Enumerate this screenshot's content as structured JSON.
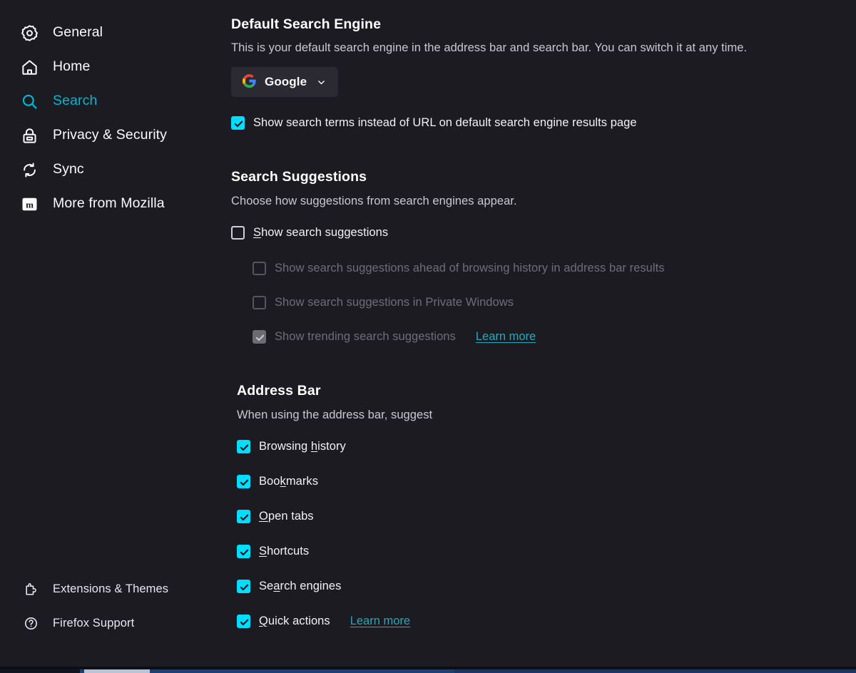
{
  "app": {
    "page": "Firefox Settings — Search"
  },
  "sidebar": {
    "items": [
      {
        "id": "general",
        "label": "General",
        "icon": "gear-icon",
        "active": false
      },
      {
        "id": "home",
        "label": "Home",
        "icon": "home-icon",
        "active": false
      },
      {
        "id": "search",
        "label": "Search",
        "icon": "search-icon",
        "active": true
      },
      {
        "id": "privacy",
        "label": "Privacy & Security",
        "icon": "lock-icon",
        "active": false
      },
      {
        "id": "sync",
        "label": "Sync",
        "icon": "sync-icon",
        "active": false
      },
      {
        "id": "mozilla",
        "label": "More from Mozilla",
        "icon": "mozilla-icon",
        "active": false
      }
    ],
    "footer": [
      {
        "id": "extensions",
        "label": "Extensions & Themes",
        "icon": "puzzle-icon"
      },
      {
        "id": "support",
        "label": "Firefox Support",
        "icon": "help-circle-icon"
      }
    ]
  },
  "default_search_engine": {
    "title": "Default Search Engine",
    "description": "This is your default search engine in the address bar and search bar. You can switch it at any time.",
    "selected_engine": "Google",
    "engine_icon": "google-g-icon",
    "chevron_icon": "chevron-down-icon",
    "checkbox": {
      "label": "Show search terms instead of URL on default search engine results page",
      "checked": true,
      "disabled": false
    }
  },
  "search_suggestions": {
    "title": "Search Suggestions",
    "description": "Choose how suggestions from search engines appear.",
    "items": [
      {
        "label_pre": "",
        "accesskey": "S",
        "label_post": "how search suggestions",
        "checked": false,
        "disabled": false,
        "indent": false,
        "learn_more": null
      },
      {
        "label_pre": "Show search suggestions ahead of browsing history in address bar results",
        "accesskey": "",
        "label_post": "",
        "checked": false,
        "disabled": true,
        "indent": true,
        "learn_more": null
      },
      {
        "label_pre": "Show search suggestions in Private Windows",
        "accesskey": "",
        "label_post": "",
        "checked": false,
        "disabled": true,
        "indent": true,
        "learn_more": null
      },
      {
        "label_pre": "Show trending search suggestions",
        "accesskey": "",
        "label_post": "",
        "checked": true,
        "disabled": true,
        "indent": true,
        "learn_more": "Learn more"
      }
    ]
  },
  "address_bar": {
    "title": "Address Bar",
    "description": "When using the address bar, suggest",
    "items": [
      {
        "label_pre": "Browsing ",
        "accesskey": "h",
        "label_post": "istory",
        "checked": true,
        "learn_more": null
      },
      {
        "label_pre": "Boo",
        "accesskey": "k",
        "label_post": "marks",
        "checked": true,
        "learn_more": null
      },
      {
        "label_pre": "",
        "accesskey": "O",
        "label_post": "pen tabs",
        "checked": true,
        "learn_more": null
      },
      {
        "label_pre": "",
        "accesskey": "S",
        "label_post": "hortcuts",
        "checked": true,
        "learn_more": null
      },
      {
        "label_pre": "Se",
        "accesskey": "a",
        "label_post": "rch engines",
        "checked": true,
        "learn_more": null
      },
      {
        "label_pre": "",
        "accesskey": "Q",
        "label_post": "uick actions",
        "checked": true,
        "learn_more": "Learn more"
      }
    ]
  },
  "colors": {
    "background": "#1c1b22",
    "accent_active": "#00b7d4",
    "checkbox_checked": "#00ddff",
    "link": "#26a8b8",
    "text_primary": "#fbfbfe",
    "text_secondary": "#c9c7d1",
    "text_disabled": "#6e6d78",
    "control_background": "#2b2a33"
  }
}
